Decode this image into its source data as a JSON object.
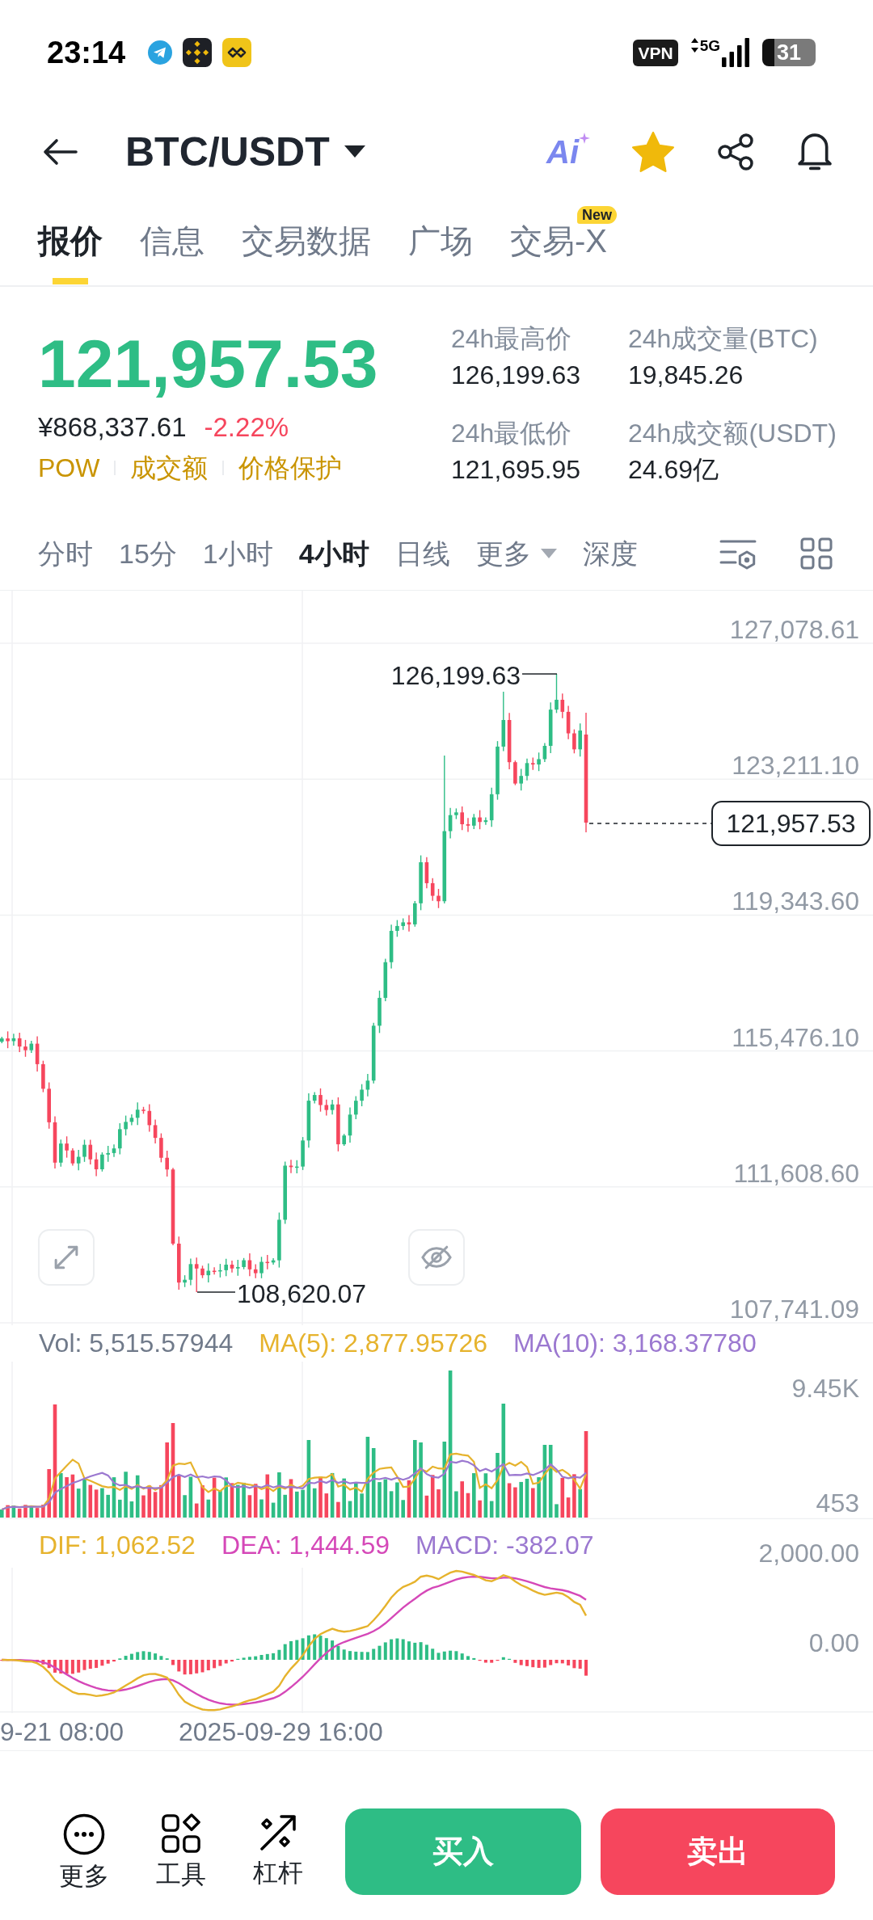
{
  "status_bar": {
    "time": "23:14",
    "vpn": "VPN",
    "network": "5G",
    "battery": "31"
  },
  "header": {
    "pair": "BTC/USDT",
    "ai_label": "Ai",
    "favorite": true
  },
  "tabs": [
    {
      "label": "报价",
      "selected": true
    },
    {
      "label": "信息",
      "selected": false
    },
    {
      "label": "交易数据",
      "selected": false
    },
    {
      "label": "广场",
      "selected": false
    },
    {
      "label": "交易-X",
      "selected": false,
      "badge": "New"
    }
  ],
  "ticker": {
    "last_price": "121,957.53",
    "price_up": true,
    "fiat_price": "¥868,337.61",
    "change": "-2.22%",
    "change_up": false,
    "tags": [
      "POW",
      "成交额",
      "价格保护"
    ],
    "stats": [
      {
        "label": "24h最高价",
        "value": "126,199.63"
      },
      {
        "label": "24h成交量(BTC)",
        "value": "19,845.26"
      },
      {
        "label": "24h最低价",
        "value": "121,695.95"
      },
      {
        "label": "24h成交额(USDT)",
        "value": "24.69亿"
      }
    ]
  },
  "intervals": [
    {
      "label": "分时",
      "selected": false
    },
    {
      "label": "15分",
      "selected": false
    },
    {
      "label": "1小时",
      "selected": false
    },
    {
      "label": "4小时",
      "selected": true
    },
    {
      "label": "日线",
      "selected": false
    },
    {
      "label": "更多",
      "selected": false,
      "dropdown": true
    },
    {
      "label": "深度",
      "selected": false
    }
  ],
  "price_chart": {
    "axis_labels": [
      "127,078.61",
      "123,211.10",
      "119,343.60",
      "115,476.10",
      "111,608.60",
      "107,741.09"
    ],
    "high_label": "126,199.63",
    "low_label": "108,620.07",
    "last_price_tag": "121,957.53"
  },
  "volume_panel": {
    "legend": [
      {
        "text": "Vol: 5,515.57944",
        "color": "#707a8a"
      },
      {
        "text": "MA(5): 2,877.95726",
        "color": "#e6b32d"
      },
      {
        "text": "MA(10): 3,168.37780",
        "color": "#9b78d0"
      }
    ],
    "axis_labels": [
      "9.45K",
      "453"
    ]
  },
  "macd_panel": {
    "legend": [
      {
        "text": "DIF: 1,062.52",
        "color": "#e6b32d"
      },
      {
        "text": "DEA: 1,444.59",
        "color": "#d548b8"
      },
      {
        "text": "MACD: -382.07",
        "color": "#9b78d0"
      }
    ],
    "axis_labels": [
      "2,000.00",
      "0.00"
    ]
  },
  "time_axis": [
    "9-21 08:00",
    "2025-09-29 16:00"
  ],
  "toolbar": [
    {
      "label": "更多",
      "kind": "more"
    },
    {
      "label": "工具",
      "kind": "tools"
    },
    {
      "label": "杠杆",
      "kind": "leverage"
    }
  ],
  "trade_buttons": [
    {
      "label": "买入",
      "kind": "buy"
    },
    {
      "label": "卖出",
      "kind": "sell"
    }
  ]
}
